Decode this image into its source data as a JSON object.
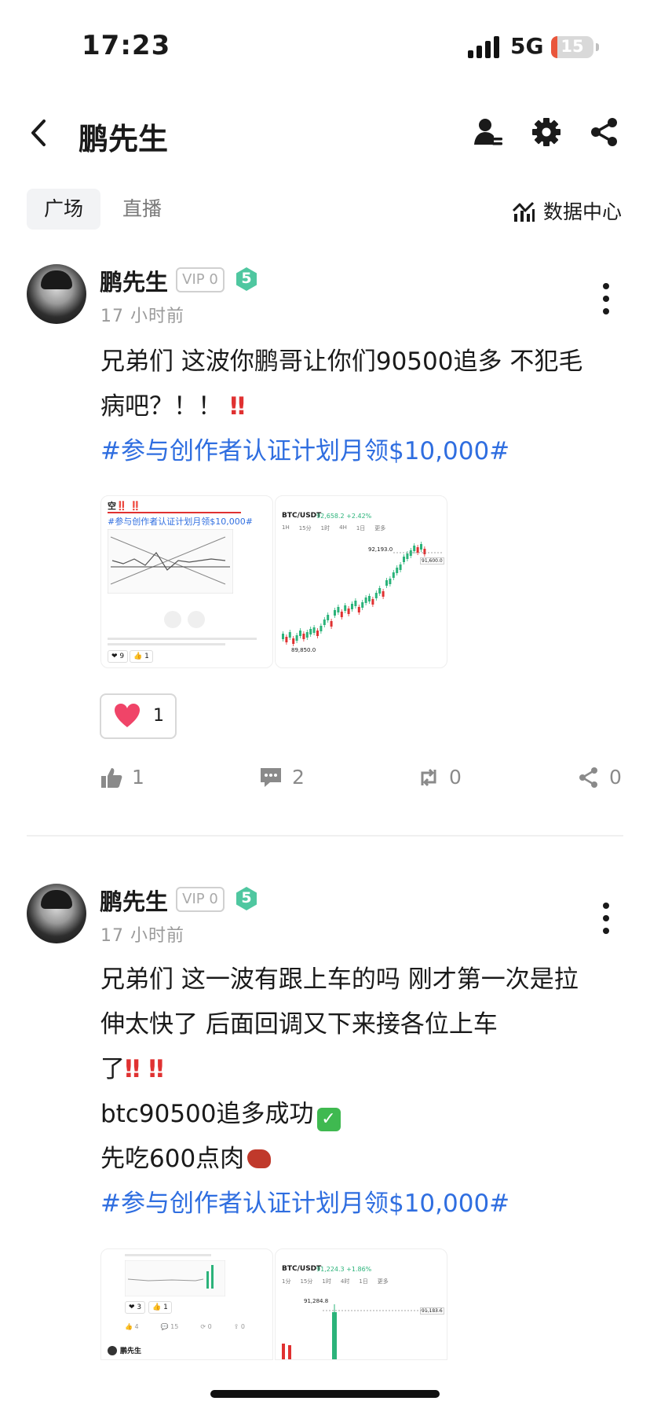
{
  "status": {
    "time": "17:23",
    "network": "5G",
    "battery": "15",
    "battery_level_percent": 15
  },
  "nav": {
    "title": "鹏先生",
    "icons": [
      "back-chevron-icon",
      "user-settings-icon",
      "gear-icon",
      "share-icon"
    ]
  },
  "tabs": [
    {
      "label": "广场",
      "active": true
    },
    {
      "label": "直播",
      "active": false
    }
  ],
  "data_center": {
    "label": "数据中心"
  },
  "posts": [
    {
      "author": "鹏先生",
      "vip": "VIP 0",
      "level": "5",
      "time_ago": "17 小时前",
      "lines": [
        "兄弟们 这波你鹏哥让你们90500追多 不犯毛",
        "病吧？！！"
      ],
      "hashtag": "#参与创作者认证计划月领$10,000#",
      "thumb1": {
        "header": "空‼️ ‼️",
        "subheader": "#参与创作者认证计划月领$10,000#",
        "likes": "9",
        "thumbs": "1"
      },
      "thumb2": {
        "title": "BTC/USDT",
        "price_change": "92,658.2 +2.42%",
        "high_label": "92,193.0",
        "low_label": "89,850.0",
        "right_label": "91,600.0",
        "intervals": [
          "1H",
          "15分",
          "1时",
          "4H",
          "1日",
          "更多"
        ]
      },
      "reaction_count": "1",
      "likes": "1",
      "comments": "2",
      "reposts": "0",
      "shares": "0"
    },
    {
      "author": "鹏先生",
      "vip": "VIP 0",
      "level": "5",
      "time_ago": "17 小时前",
      "lines": [
        "兄弟们 这一波有跟上车的吗 刚才第一次是拉",
        "伸太快了 后面回调又下来接各位上车",
        "了",
        "btc90500追多成功",
        "先吃600点肉"
      ],
      "hashtag": "#参与创作者认证计划月领$10,000#",
      "thumb1": {
        "likes": "3",
        "thumbs": "1",
        "likes2": "4",
        "comments2": "15",
        "reposts2": "0",
        "shares2": "0",
        "author": "鹏先生"
      },
      "thumb2": {
        "title": "BTC/USDT",
        "price_change": "91,224.3 +1.86%",
        "high_label": "91,284.8",
        "right_label": "91,183.6",
        "intervals": [
          "1分",
          "15分",
          "1时",
          "4时",
          "1日",
          "更多"
        ]
      }
    }
  ]
}
